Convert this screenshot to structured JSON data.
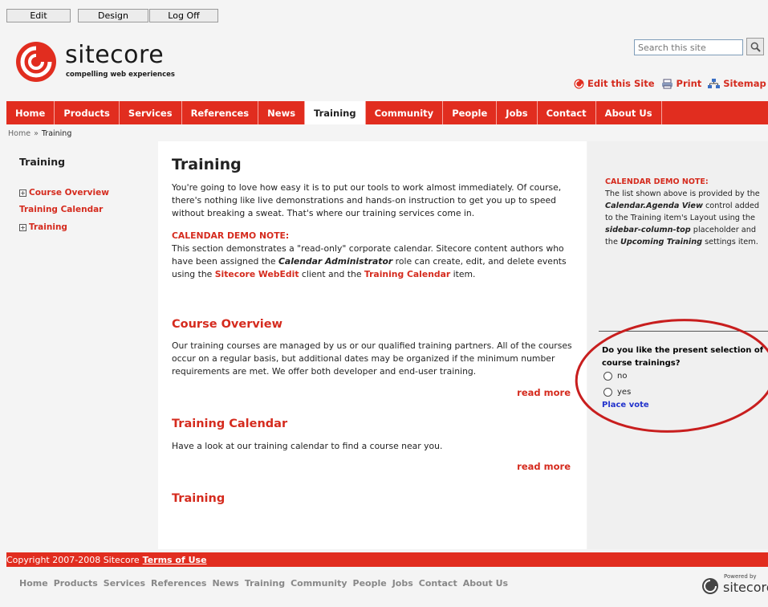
{
  "toolbar": {
    "edit": "Edit",
    "design": "Design",
    "logoff": "Log Off"
  },
  "header": {
    "logo_word": "sitecore",
    "logo_tagline": "compelling web experiences",
    "search_placeholder": "Search this site",
    "utility_links": [
      "Edit this Site",
      "Print",
      "Sitemap"
    ]
  },
  "nav": {
    "items": [
      "Home",
      "Products",
      "Services",
      "References",
      "News",
      "Training",
      "Community",
      "People",
      "Jobs",
      "Contact",
      "About Us"
    ],
    "active": "Training"
  },
  "breadcrumb": {
    "home": "Home",
    "sep": "»",
    "current": "Training"
  },
  "leftnav": {
    "title": "Training",
    "items": [
      {
        "label": "Course Overview",
        "expandable": true
      },
      {
        "label": "Training Calendar",
        "expandable": false
      },
      {
        "label": "Training",
        "expandable": true
      }
    ]
  },
  "main": {
    "title": "Training",
    "intro": "You're going to love how easy it is to put our tools to work almost immediately. Of course, there's nothing like live demonstrations and hands-on instruction to get you up to speed without breaking a sweat. That's where our training services come in.",
    "demo_head": "CALENDAR DEMO NOTE:",
    "demo_t1": "This section demonstrates a \"read-only\" corporate calendar.  Sitecore content authors who have been assigned the ",
    "demo_b1": "Calendar Administrator",
    "demo_t2": " role can create, edit, and delete events using the ",
    "demo_r1": "Sitecore WebEdit",
    "demo_t3": " client and the ",
    "demo_r2": "Training Calendar",
    "demo_t4": " item.",
    "sections": [
      {
        "title": "Course Overview",
        "text": "Our training courses are managed by us or our qualified training partners. All of the courses occur on a regular basis, but additional dates may be organized if the minimum number requirements are met. We offer both developer and end-user training.",
        "more": "read more"
      },
      {
        "title": "Training Calendar",
        "text": "Have a look at our training calendar to find a course near you.",
        "more": "read more"
      },
      {
        "title": "Training",
        "text": "",
        "more": ""
      }
    ]
  },
  "sidebar": {
    "note_head": "CALENDAR DEMO NOTE:",
    "n1": "The list shown above is provided by the ",
    "n2": "Calendar.Agenda View",
    "n3": " control added to the Training item's Layout using the ",
    "n4": "sidebar-column-top",
    "n5": " placeholder and the ",
    "n6": "Upcoming Training",
    "n7": " settings item.",
    "poll": {
      "question": "Do you like the present selection of course trainings?",
      "options": [
        "no",
        "yes"
      ],
      "vote": "Place vote"
    }
  },
  "footer": {
    "copyright": "Copyright  2007-2008  Sitecore",
    "terms": "Terms of Use",
    "links": [
      "Home",
      "Products",
      "Services",
      "References",
      "News",
      "Training",
      "Community",
      "People",
      "Jobs",
      "Contact",
      "About Us"
    ],
    "powered_by": "Powered by",
    "powered_brand": "sitecore"
  },
  "colors": {
    "brand_red": "#e12d1f",
    "link_red": "#d52b1e",
    "vote_blue": "#2233cc",
    "annotation_ellipse": "#c81e1e"
  }
}
